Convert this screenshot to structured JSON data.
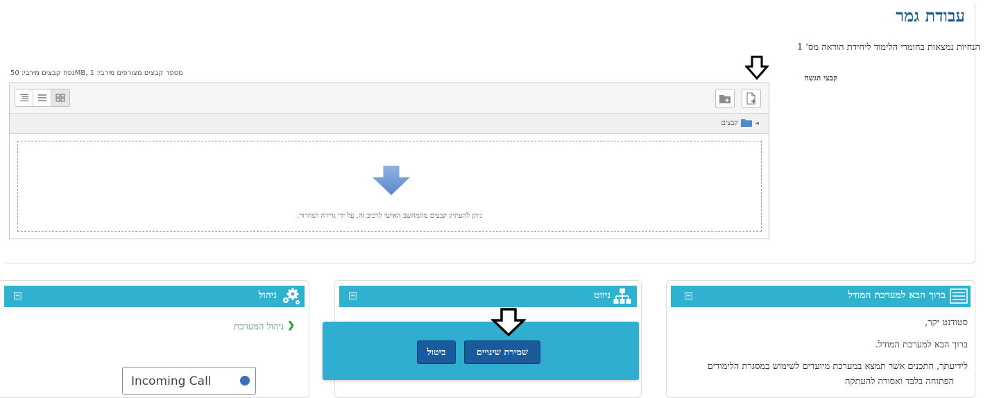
{
  "page": {
    "title": "עבודת גמר",
    "instructions": "הנחיות נמצאות בחומרי הלימוד ליחידת הוראה מס' 1",
    "submission_label": "קבצי הגשה",
    "file_limits": "נפח קבצים מירבי: 50MB, מספר קבצים מצורפים מירבי: 1"
  },
  "filemanager": {
    "path_label": "קבצים",
    "drop_text": "ניתן להעתיק קבצים מהמחשב האישי לרכיב זה, על ידי גרירה ושחרור.",
    "toolbar_icons": [
      "add-file-icon",
      "create-folder-icon",
      "view-tree-icon",
      "view-list-icon",
      "view-icons-icon"
    ]
  },
  "blocks": {
    "admin": {
      "title": "ניהול",
      "items": [
        "ניהול המערכת"
      ]
    },
    "navigation": {
      "title": "ניווט"
    },
    "welcome": {
      "title": "ברוך הבא למערכת המודל",
      "lines": [
        "סטודנט יקר,",
        "ברוך הבא למערכת המודל.",
        "לידיעתך, התכנים אשר תמצא במערכת מיועדים לשימוש במסגרת הלימודים",
        "הפתוחה בלבד ואסורה להעתקה"
      ]
    }
  },
  "dialog": {
    "save_label": "שמירת שינויים",
    "cancel_label": "ביטול"
  },
  "notification": {
    "label": "Incoming Call"
  },
  "colors": {
    "accent": "#2fb1d0",
    "title": "#1b5d8a",
    "button": "#1a5b9e",
    "dialog": "#30aed2"
  }
}
